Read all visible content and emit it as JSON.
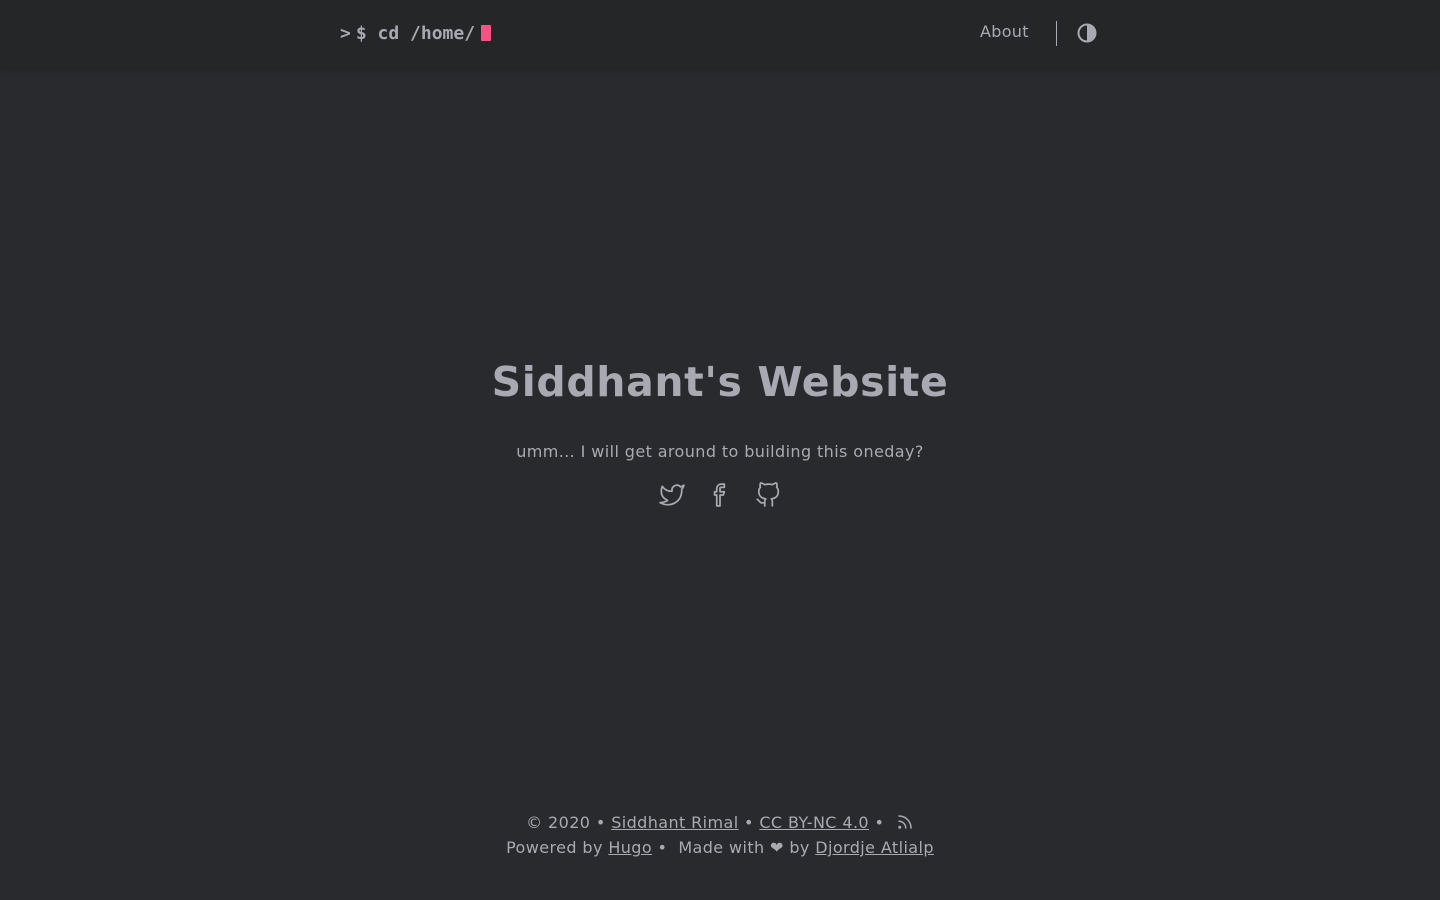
{
  "header": {
    "logo_prompt": ">",
    "logo_text": "$ cd /home/",
    "nav_about": "About",
    "theme_toggle_icon": "contrast-icon"
  },
  "main": {
    "title": "Siddhant's Website",
    "subtitle": "umm... I will get around to building this oneday?",
    "social_icons": [
      "twitter-icon",
      "facebook-icon",
      "github-icon"
    ]
  },
  "footer": {
    "copyright": "© 2020",
    "author": "Siddhant Rimal",
    "license": "CC BY-NC 4.0",
    "rss_icon": "rss-icon",
    "powered_by": "Powered by",
    "hugo": "Hugo",
    "made_with": "Made with ❤ by",
    "theme_author": "Djordje Atlialp"
  },
  "colors": {
    "background": "#292a2d",
    "header": "#252627",
    "text": "#a9a9b3",
    "cursor": "#fe5186"
  }
}
